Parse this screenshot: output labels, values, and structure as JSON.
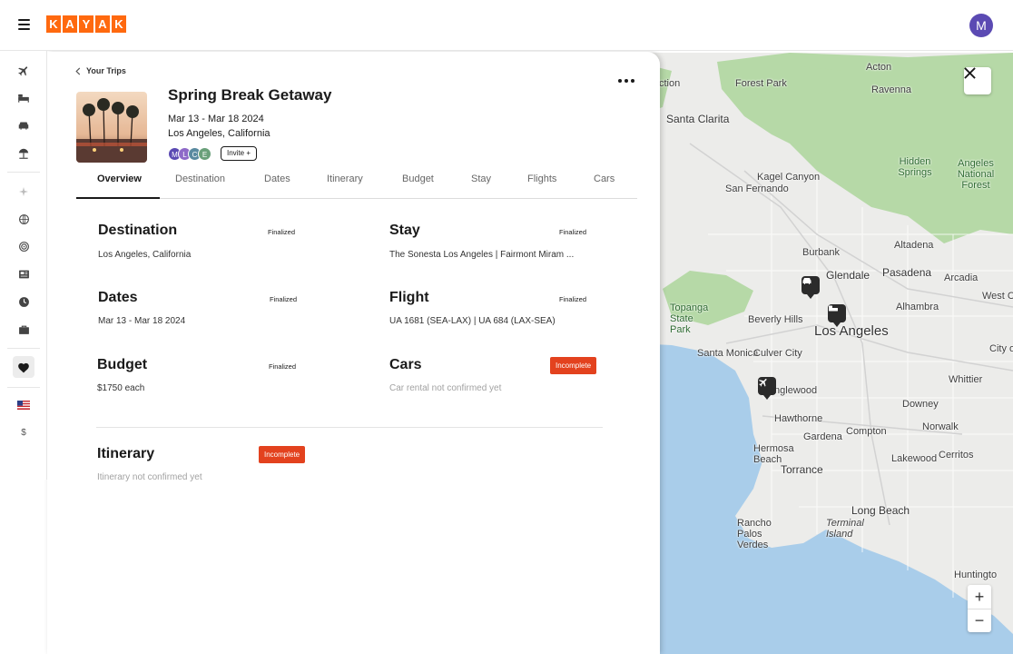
{
  "header": {
    "logo_letters": [
      "K",
      "A",
      "Y",
      "A",
      "K"
    ],
    "user_initial": "M",
    "brand_color": "#ff690f"
  },
  "leftnav": {
    "items": [
      {
        "icon": "plane-icon"
      },
      {
        "icon": "bed-icon"
      },
      {
        "icon": "car-icon"
      },
      {
        "icon": "beach-umbrella-icon"
      },
      {
        "icon": "sparkle-icon"
      },
      {
        "icon": "globe-icon"
      },
      {
        "icon": "target-icon"
      },
      {
        "icon": "news-icon"
      },
      {
        "icon": "clock-icon"
      },
      {
        "icon": "briefcase-icon"
      },
      {
        "icon": "heart-icon",
        "active": true
      },
      {
        "icon": "us-flag-icon"
      }
    ],
    "currency": "$"
  },
  "trip": {
    "breadcrumb": "Your Trips",
    "title": "Spring Break Getaway",
    "dates": "Mar 13 - Mar 18 2024",
    "location": "Los Angeles, California",
    "members": [
      {
        "initial": "M",
        "color": "#5b4ab3"
      },
      {
        "initial": "L",
        "color": "#8e6ac8"
      },
      {
        "initial": "C",
        "color": "#5a8aa0"
      },
      {
        "initial": "E",
        "color": "#6aa07a"
      }
    ],
    "invite_label": "Invite +"
  },
  "tabs": [
    "Overview",
    "Destination",
    "Dates",
    "Itinerary",
    "Budget",
    "Stay",
    "Flights",
    "Cars"
  ],
  "sections": {
    "destination": {
      "title": "Destination",
      "status": "Finalized",
      "text": "Los Angeles, California"
    },
    "stay": {
      "title": "Stay",
      "status": "Finalized",
      "text": "The Sonesta Los Angeles  |  Fairmont Miram ..."
    },
    "dates": {
      "title": "Dates",
      "status": "Finalized",
      "text": "Mar 13 - Mar 18 2024"
    },
    "flight": {
      "title": "Flight",
      "status": "Finalized",
      "text": "UA 1681 (SEA-LAX) | UA 684 (LAX-SEA)"
    },
    "budget": {
      "title": "Budget",
      "status": "Finalized",
      "text": "$1750 each"
    },
    "cars": {
      "title": "Cars",
      "status": "Incomplete",
      "text": "Car rental not confirmed yet"
    },
    "itinerary": {
      "title": "Itinerary",
      "status": "Incomplete",
      "text": "Itinerary not confirmed yet"
    }
  },
  "map": {
    "labels": {
      "acton": "Acton",
      "forest_park": "Forest Park",
      "ravenna": "Ravenna",
      "santa_clarita": "Santa Clarita",
      "ction": "ction",
      "kagel_canyon": "Kagel Canyon",
      "san_fernando": "San Fernando",
      "hidden_springs": "Hidden Springs",
      "angeles_national_forest": "Angeles National Forest",
      "burbank": "Burbank",
      "glendale": "Glendale",
      "pasadena": "Pasadena",
      "altadena": "Altadena",
      "arcadia": "Arcadia",
      "topanga_state_park": "Topanga State Park",
      "beverly_hills": "Beverly Hills",
      "alhambra": "Alhambra",
      "west_covina": "West C",
      "los_angeles": "Los Angeles",
      "santa_monica": "Santa Monica",
      "culver_city": "Culver City",
      "city_of": "City o",
      "inglewood": "Inglewood",
      "whittier": "Whittier",
      "downey": "Downey",
      "hawthorne": "Hawthorne",
      "compton": "Compton",
      "norwalk": "Norwalk",
      "gardena": "Gardena",
      "lakewood": "Lakewood",
      "cerritos": "Cerritos",
      "hermosa_beach": "Hermosa Beach",
      "torrance": "Torrance",
      "long_beach": "Long Beach",
      "rancho_palos_verdes": "Rancho Palos Verdes",
      "terminal_island": "Terminal Island",
      "huntington": "Huntingto"
    },
    "zoom_in": "+",
    "zoom_out": "−",
    "water_color": "#a9cdea",
    "park_color": "#b6d9a7"
  }
}
